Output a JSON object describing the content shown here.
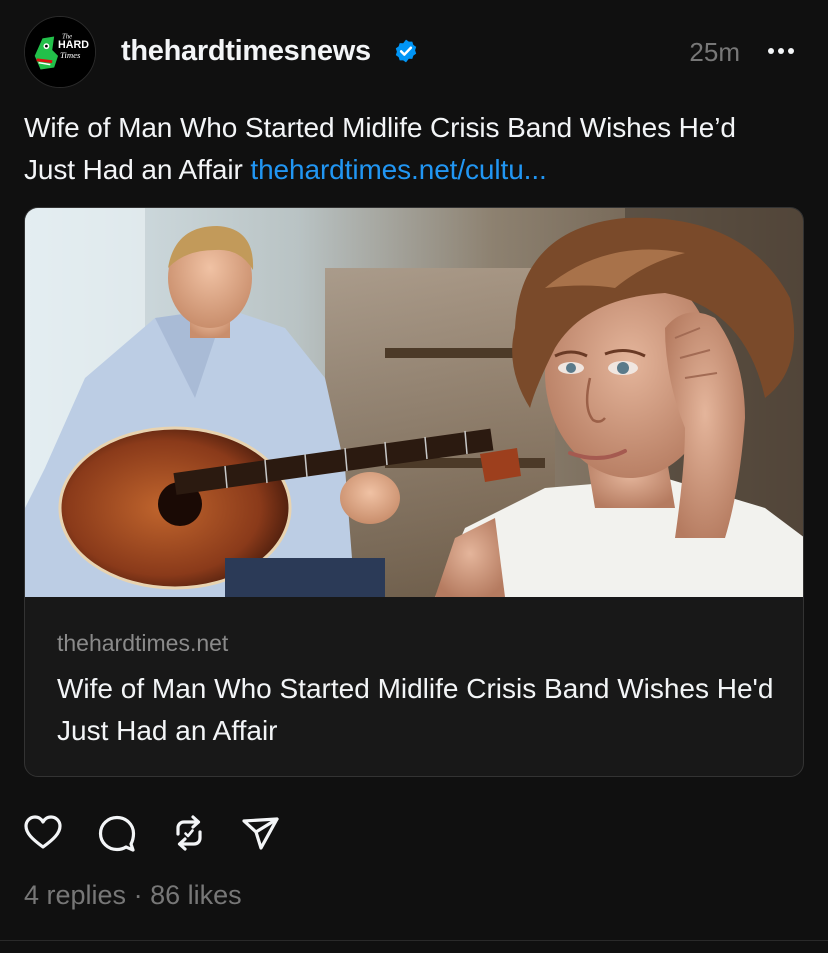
{
  "post": {
    "username": "thehardtimesnews",
    "verified": true,
    "timestamp": "25m",
    "caption_text": "Wife of Man Who Started Midlife Crisis Band Wishes He’d Just Had an Affair ",
    "caption_link": "thehardtimes.net/cultu...",
    "avatar_logo_text": [
      "The",
      "HARD",
      "Times"
    ]
  },
  "link_card": {
    "domain": "thehardtimes.net",
    "title": "Wife of Man Who Started Midlife Crisis Band Wishes He'd Just Had an Affair",
    "image_alt": "man playing acoustic guitar while woman rests head on hand"
  },
  "actions": {
    "like_icon": "heart-icon",
    "reply_icon": "comment-icon",
    "repost_icon": "repost-icon",
    "share_icon": "send-icon"
  },
  "stats": {
    "replies": "4 replies",
    "separator": " · ",
    "likes": "86 likes"
  },
  "colors": {
    "background": "#101010",
    "text": "#f3f5f7",
    "muted": "#777777",
    "link": "#2196f3",
    "verified": "#0095f6"
  }
}
